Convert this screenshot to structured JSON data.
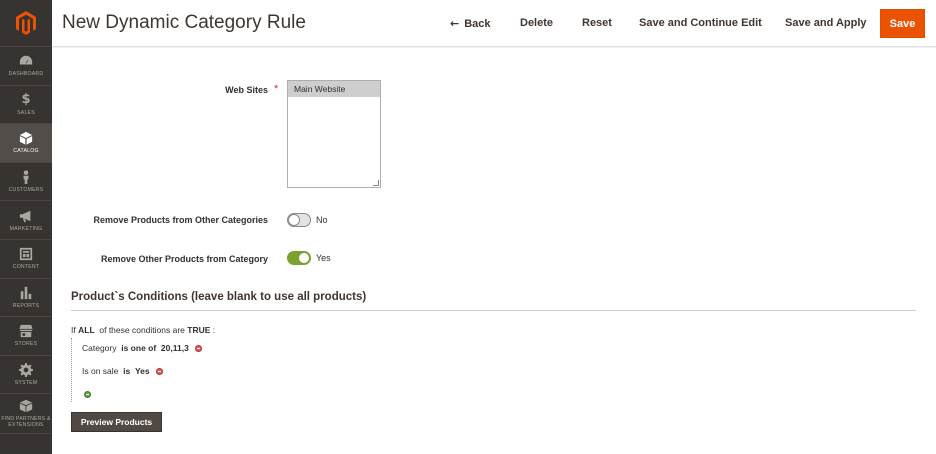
{
  "sidebar": {
    "items": [
      {
        "label": "DASHBOARD",
        "icon": "dashboard-icon"
      },
      {
        "label": "SALES",
        "icon": "dollar-icon"
      },
      {
        "label": "CATALOG",
        "icon": "cube-icon",
        "active": true
      },
      {
        "label": "CUSTOMERS",
        "icon": "person-icon"
      },
      {
        "label": "MARKETING",
        "icon": "megaphone-icon"
      },
      {
        "label": "CONTENT",
        "icon": "content-icon"
      },
      {
        "label": "REPORTS",
        "icon": "bar-chart-icon"
      },
      {
        "label": "STORES",
        "icon": "store-icon"
      },
      {
        "label": "SYSTEM",
        "icon": "gear-icon"
      },
      {
        "label": "FIND PARTNERS & EXTENSIONS",
        "icon": "box-icon"
      }
    ]
  },
  "header": {
    "title": "New Dynamic Category Rule",
    "back_label": "Back",
    "delete_label": "Delete",
    "reset_label": "Reset",
    "save_continue_label": "Save and Continue Edit",
    "save_apply_label": "Save and Apply",
    "save_label": "Save"
  },
  "form": {
    "web_sites_label": "Web Sites",
    "web_sites_required": "*",
    "web_sites_options": [
      "Main Website"
    ],
    "remove_other_categories_label": "Remove Products from Other Categories",
    "remove_other_categories_value": "No",
    "remove_other_products_label": "Remove Other Products from Category",
    "remove_other_products_value": "Yes"
  },
  "conditions": {
    "title": "Product`s Conditions (leave blank to use all products)",
    "head_if": "If",
    "head_aggregator": "ALL",
    "head_middle": "of these conditions are",
    "head_value": "TRUE",
    "head_end": ":",
    "rows": [
      {
        "attribute": "Category",
        "operator": "is one of",
        "value": "20,11,3"
      },
      {
        "attribute": "Is on sale",
        "operator": "is",
        "value": "Yes"
      }
    ],
    "preview_label": "Preview Products"
  },
  "colors": {
    "accent": "#eb5202",
    "sidebar_bg": "#373330",
    "toggle_on": "#79a22e"
  }
}
